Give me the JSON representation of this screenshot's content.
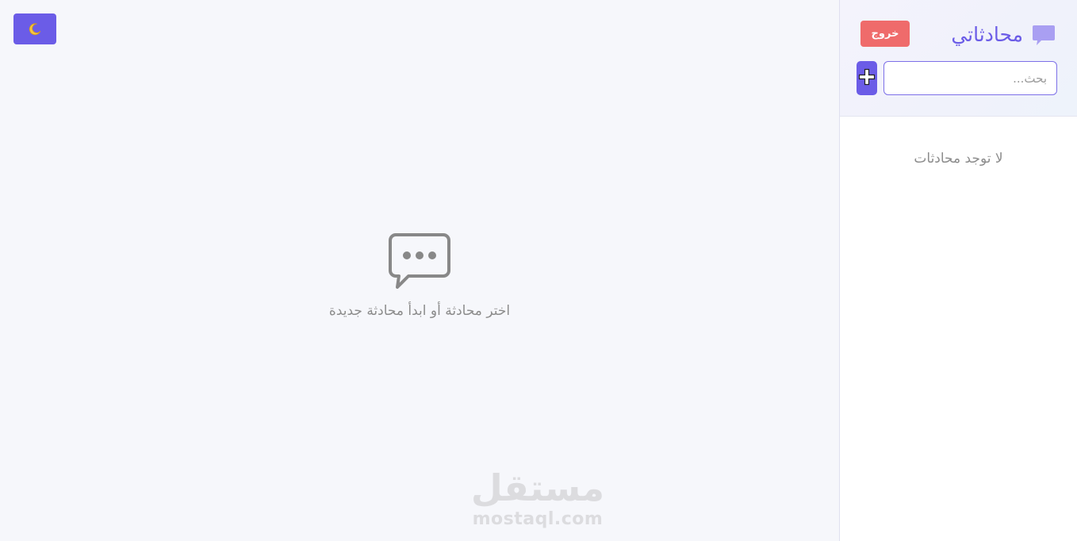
{
  "theme_toggle": {
    "icon": "moon-icon"
  },
  "main": {
    "empty_icon": "chat-bubble-icon",
    "empty_text": "اختر محادثة أو ابدأ محادثة جديدة"
  },
  "watermark": {
    "arabic": "مستقل",
    "latin": "mostaql.com"
  },
  "sidebar": {
    "title": "محادثاتي",
    "title_icon": "chat-icon",
    "logout_label": "خروج",
    "search_placeholder": "بحث...",
    "add_icon": "plus-icon",
    "empty_text": "لا توجد محادثات"
  },
  "colors": {
    "accent": "#6b5ce7",
    "danger": "#ef6b6b",
    "background": "#f6f7fb"
  }
}
